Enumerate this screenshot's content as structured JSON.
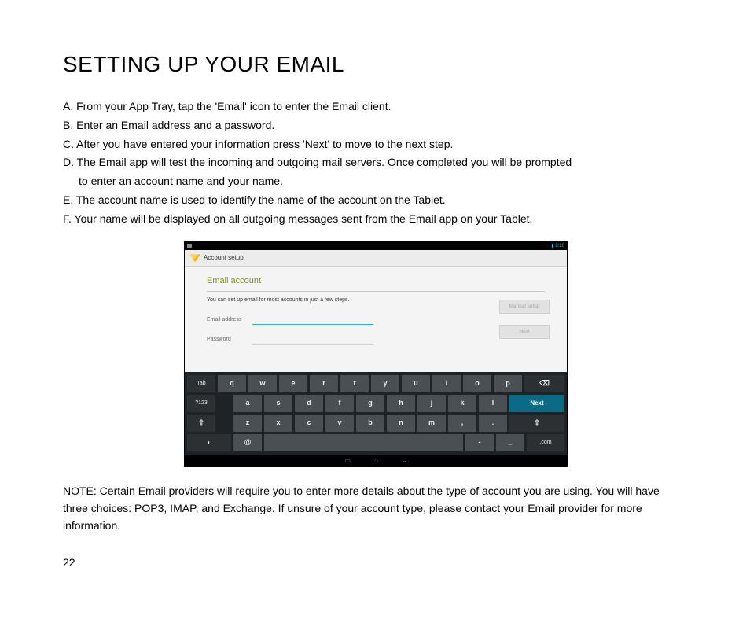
{
  "title": "SETTING UP YOUR EMAIL",
  "steps": {
    "a": "A.  From your App Tray, tap the 'Email' icon to enter the Email client.",
    "b": "B.  Enter an Email address and a password.",
    "c": "C.  After you have entered your information press 'Next' to move to the next step.",
    "d1": "D. The Email app will test the incoming and outgoing mail servers.  Once completed you will be prompted",
    "d2": "to enter an account name and your name.",
    "e": "E. The account name is used to identify the name of the account on the Tablet.",
    "f": "F. Your name will be displayed on all outgoing messages sent from the Email app on your Tablet."
  },
  "screenshot": {
    "status_time": "8:20",
    "header": "Account setup",
    "form_title": "Email account",
    "form_desc": "You can set up email for most accounts in just a few steps.",
    "email_label": "Email address",
    "password_label": "Password",
    "manual_btn": "Manual setup",
    "next_btn": "Next",
    "keyboard": {
      "row1_side": "Tab",
      "row1": [
        "q",
        "w",
        "e",
        "r",
        "t",
        "y",
        "u",
        "i",
        "o",
        "p"
      ],
      "row1_bksp": "⌫",
      "row2_side": "?123",
      "row2": [
        "a",
        "s",
        "d",
        "f",
        "g",
        "h",
        "j",
        "k",
        "l"
      ],
      "row2_next": "Next",
      "row3_shiftL": "⇧",
      "row3": [
        "z",
        "x",
        "c",
        "v",
        "b",
        "n",
        "m",
        ",",
        "."
      ],
      "row3_shiftR": "⇧",
      "row4_lang": "◐",
      "row4_at": "@",
      "row4_dash": "-",
      "row4_under": "_",
      "row4_com": ".com"
    }
  },
  "note": "NOTE: Certain Email providers will require you to enter more details about the type of account you are using. You will have three choices: POP3, IMAP, and Exchange. If unsure of your account type, please contact your Email provider for more information.",
  "page_number": "22"
}
